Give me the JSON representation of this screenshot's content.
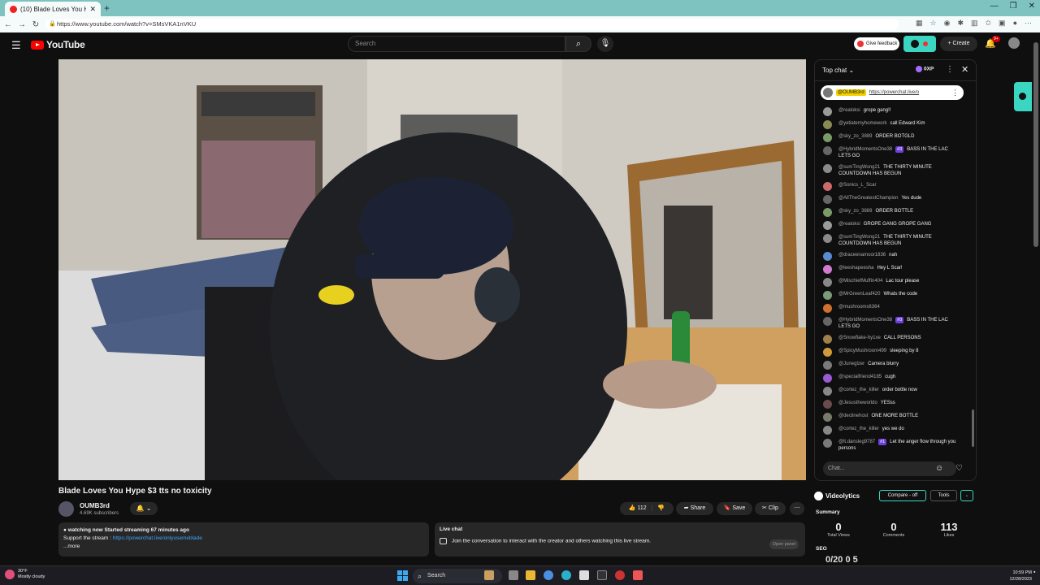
{
  "browser": {
    "tab_title": "(10) Blade Loves You Hype $3 tts n",
    "url": "https://www.youtube.com/watch?v=SMsVKA1nVKU"
  },
  "header": {
    "logo_text": "YouTube",
    "search_placeholder": "Search",
    "feedback_label": "Give feedback",
    "create_label": "+ Create",
    "bell_badge": "9+"
  },
  "video": {
    "title": "Blade Loves You Hype $3 tts no toxicity",
    "channel_name": "OUMB3rd",
    "subscribers": "4.69K subscribers",
    "likes": "112",
    "share_label": "Share",
    "save_label": "Save",
    "clip_label": "Clip"
  },
  "description": {
    "line1_bold": "watching now  Started streaming 67 minutes ago",
    "line2_prefix": "Support the stream : ",
    "line2_link": "https://powerchat.live/onlyusemeblade",
    "more": "...more"
  },
  "livechat_box": {
    "heading": "Live chat",
    "text": "Join the conversation to interact with the creator and others watching this live stream.",
    "open_panel": "Open panel"
  },
  "chat": {
    "header_label": "Top chat",
    "xp_label": "0XP",
    "pinned_user": "@OUMB3rd",
    "pinned_link": "https://powerchat.live/o",
    "input_placeholder": "Chat...",
    "messages": [
      {
        "user": "@realoksi",
        "text": "grope gang!!",
        "color": "#9a9a9a"
      },
      {
        "user": "@yetiatemyhomework",
        "text": "call Edward Kim",
        "color": "#8a8a55"
      },
      {
        "user": "@sky_zo_3889",
        "text": "ORDER BOTGLD",
        "color": "#7a9a6a"
      },
      {
        "user": "@HybridMomentsOne38",
        "badge": "#3",
        "text": "BASS IN THE LAC LETS GO",
        "color": "#666"
      },
      {
        "user": "@sumTingWong21",
        "text": "THE THIRTY MINUTE COUNTDOWN HAS BEGUN",
        "color": "#8a8a8a"
      },
      {
        "user": "@Sonics_L_Scar",
        "text": "",
        "color": "#cc6a6a"
      },
      {
        "user": "@AllTheGreatestChampion",
        "text": "Yes dude",
        "color": "#666"
      },
      {
        "user": "@sky_zo_3889",
        "text": "ORDER BOTTLE",
        "color": "#7a9a6a"
      },
      {
        "user": "@realoksi",
        "text": "GROPE GANG GROPE GANG",
        "color": "#9a9a9a"
      },
      {
        "user": "@sumTingWong21",
        "text": "THE THIRTY MINUTE COUNTDOWN HAS BEGUN",
        "color": "#8a8a8a"
      },
      {
        "user": "@draceenamoor1836",
        "text": "nah",
        "color": "#5a8ad0"
      },
      {
        "user": "@leeshapeesha",
        "text": "Hey L Scar!",
        "color": "#d07ad0"
      },
      {
        "user": "@MischiefMuffin404",
        "text": "Lac tour please",
        "color": "#888"
      },
      {
        "user": "@MrGreenLeaf420",
        "text": "Whats the code",
        "color": "#7a9a7a"
      },
      {
        "user": "@mushrooms6364",
        "text": "",
        "color": "#d0702a"
      },
      {
        "user": "@HybridMomentsOne38",
        "badge": "#3",
        "text": "BASS IN THE LAC LETS GO",
        "color": "#666"
      },
      {
        "user": "@Snowflake-hy1xe",
        "text": "CALL PERSONS",
        "color": "#a0804a"
      },
      {
        "user": "@SpicyMushroom499",
        "text": "sleeping by 8",
        "color": "#d09a3a"
      },
      {
        "user": "@Juneglzer",
        "text": "Camera blurry",
        "color": "#7a7a7a"
      },
      {
        "user": "@specialfriend4185",
        "text": "cugh",
        "color": "#9a5ad0"
      },
      {
        "user": "@cortez_the_killer",
        "text": "order bottle now",
        "color": "#888"
      },
      {
        "user": "@Jesustheworldo",
        "text": "YESss",
        "color": "#6a4a4a"
      },
      {
        "user": "@declinehost",
        "text": "ONE MORE BOTTLE",
        "color": "#7a7a6a"
      },
      {
        "user": "@cortez_the_killer",
        "text": "yes we do",
        "color": "#888"
      },
      {
        "user": "@lt.dansleg9787",
        "badge": "#1",
        "text": "Let the anger flow through you persons",
        "color": "#7a7a7a"
      }
    ]
  },
  "videolytics": {
    "name": "Videolytics",
    "compare": "Compare - off",
    "tools": "Tools",
    "summary": "Summary",
    "stats": [
      {
        "value": "0",
        "label": "Total Views"
      },
      {
        "value": "0",
        "label": "Comments"
      },
      {
        "value": "113",
        "label": "Likes"
      }
    ],
    "seo": "SEO",
    "seo_values": "0/20          0          5"
  },
  "taskbar": {
    "weather_temp": "30°F",
    "weather_desc": "Mostly cloudy",
    "search_label": "Search",
    "time": "10:59 PM",
    "date": "12/28/2023"
  }
}
